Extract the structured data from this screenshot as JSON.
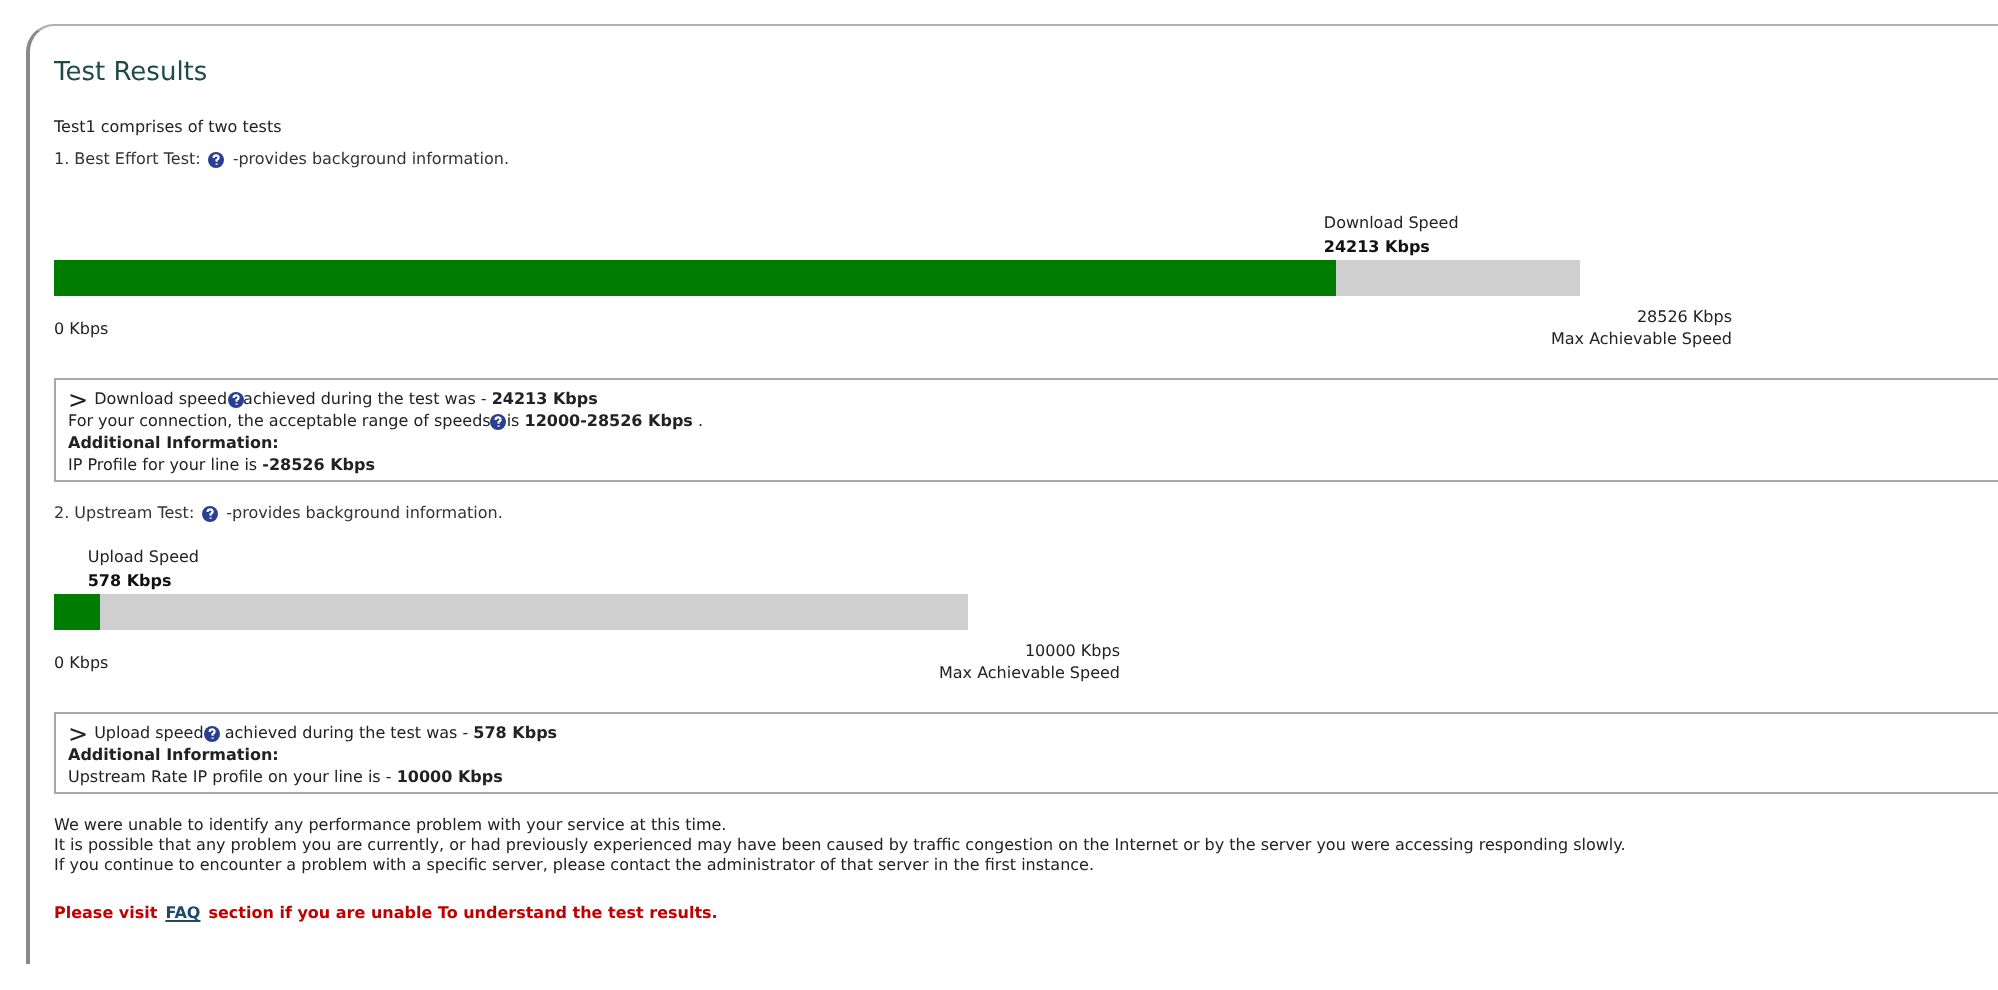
{
  "title": "Test Results",
  "intro": "Test1 comprises of two tests",
  "tests": [
    {
      "heading": "1. Best Effort Test:",
      "heading_note": "-provides background information.",
      "speed_label": "Download Speed",
      "speed_value": "24213 Kbps",
      "level": 0.84,
      "min_label": "0 Kbps",
      "max_value": "28526 Kbps",
      "max_label": "Max Achievable Speed",
      "details": [
        {
          "kind": "help",
          "arrow": ">",
          "text": "Download speed",
          "rest": "achieved during the test was - **24213 Kbps**"
        },
        {
          "kind": "help",
          "text": "For your connection, the acceptable range of speeds",
          "rest": "is **12000-28526 Kbps** ."
        },
        {
          "kind": "heading",
          "text": "Additional Information:"
        },
        {
          "kind": "plain",
          "text": "IP Profile for your line is **-28526 Kbps**"
        }
      ]
    },
    {
      "heading": "2. Upstream Test:",
      "heading_note": "-provides background information.",
      "speed_label": "Upload Speed",
      "speed_value": "578 Kbps",
      "level": 0.05,
      "min_label": "0 Kbps",
      "max_value": "10000 Kbps",
      "max_label": "Max Achievable Speed",
      "details": [
        {
          "kind": "help",
          "arrow": ">",
          "text": "Upload speed",
          "rest": " achieved during the test was - **578 Kbps**"
        },
        {
          "kind": "heading",
          "text": "Additional Information:"
        },
        {
          "kind": "plain",
          "text": "Upstream Rate IP profile on your line is - **10000 Kbps**"
        }
      ]
    }
  ],
  "summary": [
    "We were unable to identify any performance problem with your service at this time.",
    "It is possible that any problem you are currently, or had previously experienced may have been caused by traffic congestion on the Internet or by the server you were accessing responding slowly.",
    "If you continue to encounter a problem with a specific server, please contact the administrator of that server in the first instance."
  ],
  "notice": {
    "before": "Please visit",
    "link": "FAQ",
    "after": "section if you are unable To understand the test results."
  }
}
